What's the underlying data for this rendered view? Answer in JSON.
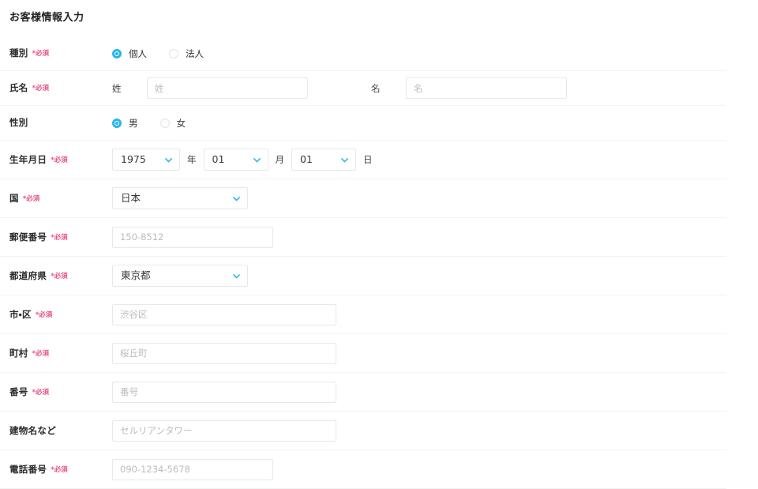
{
  "form": {
    "title": "お客様情報入力",
    "required_marker": "*必須",
    "accent_color": "#29b6e8",
    "required_color": "#e8527f",
    "border_color": "#e6e8ea",
    "divider_color": "#f2f3f5",
    "rows": {
      "type": {
        "label": "種別",
        "required": "*必須",
        "options": [
          {
            "label": "個人",
            "selected": true
          },
          {
            "label": "法人",
            "selected": false
          }
        ]
      },
      "name": {
        "label": "氏名",
        "required": "*必須",
        "last_name_label": "姓",
        "last_name_placeholder": "姓",
        "last_name_value": "",
        "first_name_label": "名",
        "first_name_placeholder": "名",
        "first_name_value": ""
      },
      "gender": {
        "label": "性別",
        "required": "",
        "options": [
          {
            "label": "男",
            "selected": true
          },
          {
            "label": "女",
            "selected": false
          }
        ]
      },
      "birthday": {
        "label": "生年月日",
        "required": "*必須",
        "year_value": "1975",
        "year_unit": "年",
        "month_value": "01",
        "month_unit": "月",
        "day_value": "01",
        "day_unit": "日"
      },
      "country": {
        "label": "国",
        "required": "*必須",
        "value": "日本"
      },
      "zip": {
        "label": "郵便番号",
        "required": "*必須",
        "placeholder": "150-8512",
        "value": ""
      },
      "prefecture": {
        "label": "都道府県",
        "required": "*必須",
        "value": "東京都"
      },
      "city": {
        "label": "市・区",
        "required": "*必須",
        "placeholder": "渋谷区",
        "value": ""
      },
      "town": {
        "label": "町村",
        "required": "*必須",
        "placeholder": "桜丘町",
        "value": ""
      },
      "number": {
        "label": "番号",
        "required": "*必須",
        "placeholder": "番号",
        "value": ""
      },
      "building": {
        "label": "建物名など",
        "required": "",
        "placeholder": "セルリアンタワー",
        "value": ""
      },
      "phone": {
        "label": "電話番号",
        "required": "*必須",
        "placeholder": "090-1234-5678",
        "value": ""
      }
    }
  }
}
